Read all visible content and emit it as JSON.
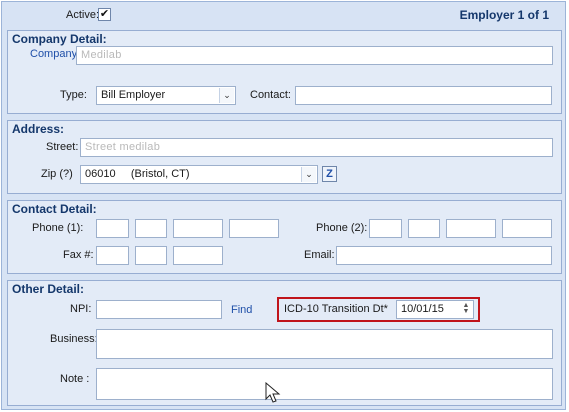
{
  "header": {
    "active_label": "Active:",
    "active_checked": true,
    "record_counter": "Employer 1 of 1"
  },
  "company": {
    "section_title": "Company Detail:",
    "company_label": "Company*",
    "company_value": "Medilab",
    "type_label": "Type:",
    "type_value": "Bill Employer",
    "contact_label": "Contact:",
    "contact_value": ""
  },
  "address": {
    "section_title": "Address:",
    "street_label": "Street:",
    "street_value": "Street medilab",
    "zip_label": "Zip (?)",
    "zip_value": "06010     (Bristol, CT)",
    "zip_lookup_icon": "Z"
  },
  "contact_detail": {
    "section_title": "Contact Detail:",
    "phone1_label": "Phone (1):",
    "phone2_label": "Phone (2):",
    "fax_label": "Fax #:",
    "email_label": "Email:"
  },
  "other": {
    "section_title": "Other Detail:",
    "npi_label": "NPI:",
    "find_label": "Find",
    "icd_label": "ICD-10 Transition Dt*",
    "icd_value": "10/01/15",
    "business_label": "Business:",
    "note_label": "Note :"
  },
  "colors": {
    "panel_bg": "#d7e3f4",
    "section_title": "#14376b",
    "highlight": "#c0141b",
    "link": "#1f4fa8"
  }
}
